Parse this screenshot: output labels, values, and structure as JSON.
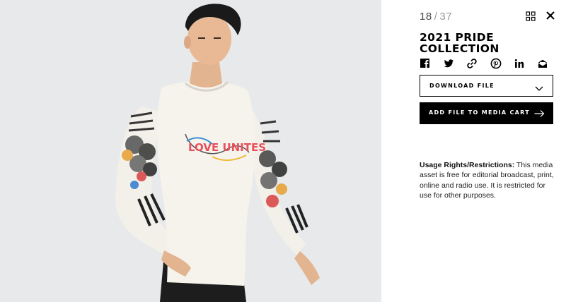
{
  "counter": {
    "current": "18",
    "separator": "/",
    "total": "37"
  },
  "asset": {
    "title": "2021 PRIDE COLLECTION"
  },
  "share": {
    "icons": [
      "facebook-icon",
      "twitter-icon",
      "link-icon",
      "pinterest-icon",
      "linkedin-icon",
      "email-icon"
    ]
  },
  "actions": {
    "download_label": "DOWNLOAD FILE",
    "add_to_cart_label": "ADD FILE TO MEDIA CART"
  },
  "usage": {
    "heading": "Usage Rights/Restrictions:",
    "text": " This media asset is free for editorial broadcast, print, online and radio use. It is restricted for use for other purposes."
  },
  "photo": {
    "shirt_graphic_text": "LOVE UNITES"
  },
  "colors": {
    "background_photo": "#e7e9ea",
    "cart_button": "#000000",
    "text": "#000000"
  }
}
